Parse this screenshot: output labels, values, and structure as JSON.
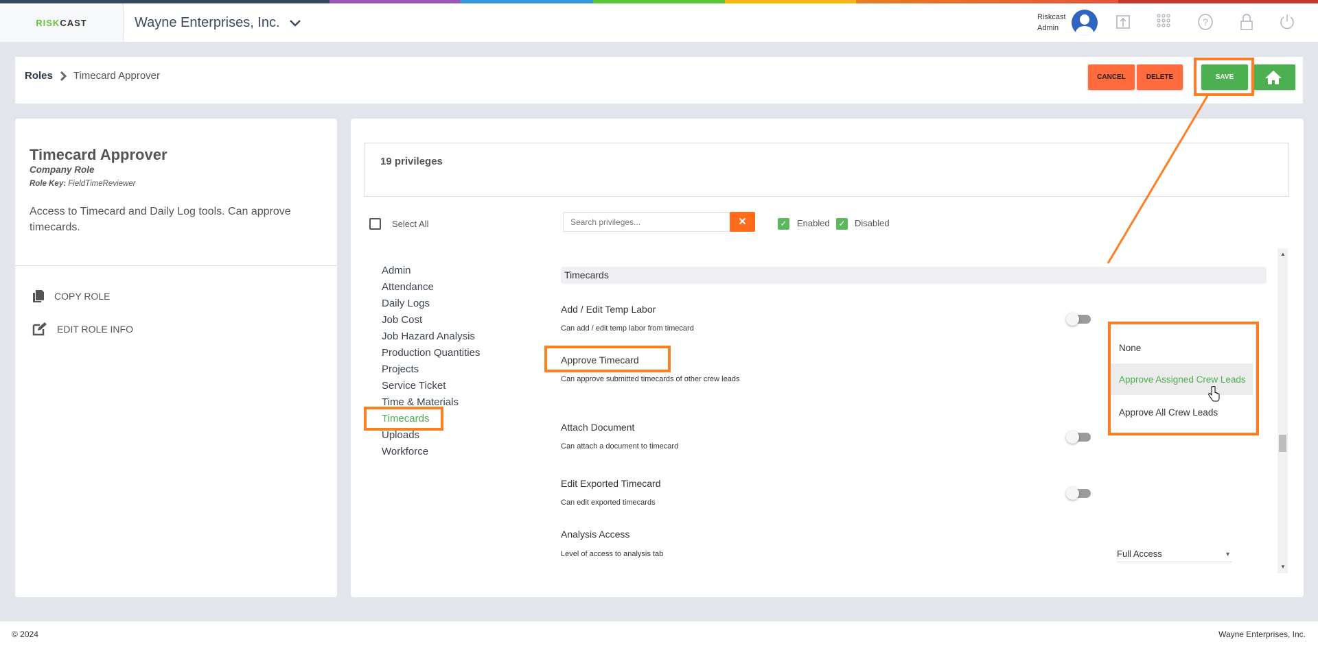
{
  "header": {
    "logo_text": "RISKCAST",
    "company": "Wayne Enterprises, Inc.",
    "user_line1": "Riskcast",
    "user_line2": "Admin",
    "icons": [
      "user-avatar-icon",
      "upload-icon",
      "apps-grid-icon",
      "help-icon",
      "lock-icon",
      "power-icon"
    ],
    "strip_colors": [
      "#34495e",
      "#9b59b6",
      "#3498db",
      "#5cc33b",
      "#f5b70f",
      "#e67e22",
      "#c0392b"
    ]
  },
  "breadcrumb": {
    "root": "Roles",
    "current": "Timecard Approver"
  },
  "toolbar": {
    "cancel": "CANCEL",
    "delete": "DELETE",
    "save": "SAVE",
    "home_icon": "home-icon"
  },
  "role": {
    "title": "Timecard Approver",
    "type": "Company Role",
    "key_label": "Role Key:",
    "key_value": "FieldTimeReviewer",
    "description": "Access to Timecard and Daily Log tools. Can approve timecards.",
    "actions": [
      {
        "label": "COPY ROLE",
        "icon": "copy-icon"
      },
      {
        "label": "EDIT ROLE INFO",
        "icon": "edit-icon"
      }
    ]
  },
  "privileges": {
    "count_label": "19 privileges",
    "select_all": "Select All",
    "search_placeholder": "Search privileges...",
    "filter_enabled": "Enabled",
    "filter_disabled": "Disabled",
    "categories": [
      "Admin",
      "Attendance",
      "Daily Logs",
      "Job Cost",
      "Job Hazard Analysis",
      "Production Quantities",
      "Projects",
      "Service Ticket",
      "Time & Materials",
      "Timecards",
      "Uploads",
      "Workforce"
    ],
    "selected_category": "Timecards",
    "section_title": "Timecards",
    "items": [
      {
        "title": "Add / Edit Temp Labor",
        "desc": "Can add / edit temp labor from timecard",
        "enabled": false
      },
      {
        "title": "Approve Timecard",
        "desc": "Can approve submitted timecards of other crew leads"
      },
      {
        "title": "Attach Document",
        "desc": "Can attach a document to timecard",
        "enabled": false
      },
      {
        "title": "Edit Exported Timecard",
        "desc": "Can edit exported timecards",
        "enabled": false
      },
      {
        "title": "Analysis Access",
        "desc": "Level of access to analysis tab",
        "value": "Full Access"
      }
    ],
    "dropdown_options": [
      "None",
      "Approve Assigned Crew Leads",
      "Approve All Crew Leads"
    ],
    "hovered_option": "Approve Assigned Crew Leads"
  },
  "colors": {
    "accent_green": "#4caf50",
    "accent_orange": "#ff6b3d",
    "highlight": "#fd7e23"
  },
  "footer": {
    "copyright": "© 2024",
    "company": "Wayne Enterprises, Inc."
  }
}
